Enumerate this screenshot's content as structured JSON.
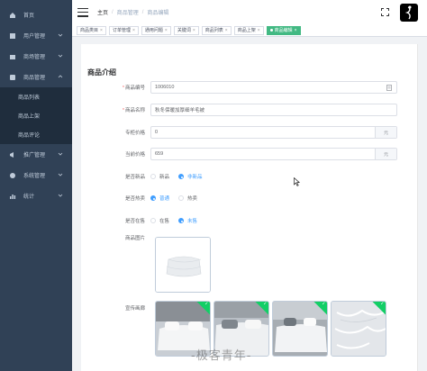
{
  "sidebar": {
    "items": [
      {
        "label": "首页",
        "icon": "home-icon",
        "has_children": false
      },
      {
        "label": "用户管理",
        "icon": "user-icon",
        "has_children": true
      },
      {
        "label": "商场管理",
        "icon": "shop-icon",
        "has_children": true
      },
      {
        "label": "商品管理",
        "icon": "goods-icon",
        "has_children": true,
        "expanded": true
      },
      {
        "label": "推广管理",
        "icon": "promotion-icon",
        "has_children": true
      },
      {
        "label": "系统管理",
        "icon": "system-icon",
        "has_children": true
      },
      {
        "label": "统计",
        "icon": "chart-icon",
        "has_children": true
      }
    ],
    "sub_items": [
      "商品列表",
      "商品上架",
      "商品评论"
    ]
  },
  "header": {
    "breadcrumb": [
      "主页",
      "商品管理",
      "商品编辑"
    ],
    "fullscreen_icon": "fullscreen-icon",
    "avatar_icon": "avatar-icon"
  },
  "tags": [
    {
      "label": "商品类目",
      "active": false
    },
    {
      "label": "订单管理",
      "active": false
    },
    {
      "label": "通用问题",
      "active": false
    },
    {
      "label": "关键词",
      "active": false
    },
    {
      "label": "商品列表",
      "active": false
    },
    {
      "label": "商品上架",
      "active": false
    },
    {
      "label": "商品编辑",
      "active": true
    }
  ],
  "form": {
    "title": "商品介绍",
    "goods_sn": {
      "label": "商品编号",
      "value": "1006010"
    },
    "name": {
      "label": "商品名称",
      "value": "秋冬保暖加厚细羊毛被"
    },
    "counter_price": {
      "label": "专柜价格",
      "value": "0",
      "unit": "元"
    },
    "retail_price": {
      "label": "当前价格",
      "value": "659",
      "unit": "元"
    },
    "is_new": {
      "label": "是否新品",
      "options": [
        "新品",
        "非新品"
      ],
      "selected": "非新品"
    },
    "is_hot": {
      "label": "是否热卖",
      "options": [
        "普通",
        "热卖"
      ],
      "selected": "普通"
    },
    "is_on_sale": {
      "label": "是否在售",
      "options": [
        "在售",
        "未售"
      ],
      "selected": "未售"
    },
    "pic_label": "商品图片",
    "gallery_label": "宣传画廊"
  },
  "watermark": "-极客青年-",
  "colors": {
    "sidebar_bg": "#304156",
    "sidebar_sub_bg": "#1f2d3d",
    "active_tag": "#42b983",
    "primary": "#409eff",
    "success_badge": "#13ce66"
  }
}
